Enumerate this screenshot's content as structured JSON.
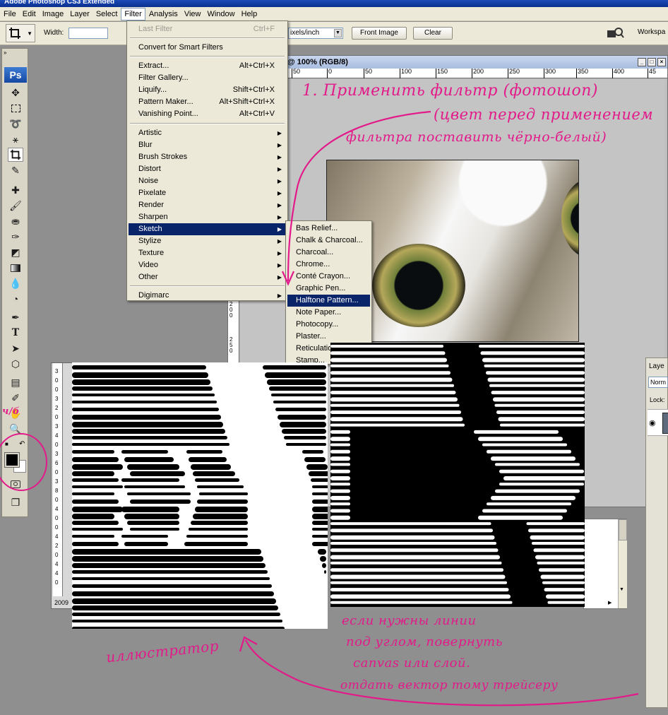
{
  "app": {
    "title": "Adobe Photoshop CS3 Extended"
  },
  "menubar": [
    "File",
    "Edit",
    "Image",
    "Layer",
    "Select",
    "Filter",
    "Analysis",
    "View",
    "Window",
    "Help"
  ],
  "options": {
    "width_label": "Width:",
    "resolution_unit": "ixels/inch",
    "front_image": "Front Image",
    "clear": "Clear",
    "workspace": "Workspa"
  },
  "toolbox": {
    "logo": "Ps"
  },
  "document": {
    "title": "@ 100% (RGB/8)",
    "ruler_ticks": [
      "50",
      "0",
      "50",
      "100",
      "150",
      "200",
      "250",
      "300",
      "350",
      "400",
      "45"
    ],
    "vruler_ticks": [
      "2",
      "0",
      "0",
      "2",
      "5",
      "0"
    ],
    "left_vruler_ticks": [
      "3",
      "0",
      "0",
      "3",
      "2",
      "0",
      "3",
      "4",
      "0",
      "3",
      "6",
      "0",
      "3",
      "8",
      "0",
      "4",
      "0",
      "0",
      "4",
      "2",
      "0",
      "4",
      "4",
      "0"
    ],
    "status": "2009"
  },
  "filter_menu": {
    "items": [
      {
        "label": "Last Filter",
        "shortcut": "Ctrl+F",
        "disabled": true
      },
      {
        "label": "Convert for Smart Filters"
      },
      {
        "label": "Extract...",
        "shortcut": "Alt+Ctrl+X"
      },
      {
        "label": "Filter Gallery..."
      },
      {
        "label": "Liquify...",
        "shortcut": "Shift+Ctrl+X"
      },
      {
        "label": "Pattern Maker...",
        "shortcut": "Alt+Shift+Ctrl+X"
      },
      {
        "label": "Vanishing Point...",
        "shortcut": "Alt+Ctrl+V"
      },
      {
        "label": "Artistic"
      },
      {
        "label": "Blur"
      },
      {
        "label": "Brush Strokes"
      },
      {
        "label": "Distort"
      },
      {
        "label": "Noise"
      },
      {
        "label": "Pixelate"
      },
      {
        "label": "Render"
      },
      {
        "label": "Sharpen"
      },
      {
        "label": "Sketch",
        "highlighted": true
      },
      {
        "label": "Stylize"
      },
      {
        "label": "Texture"
      },
      {
        "label": "Video"
      },
      {
        "label": "Other"
      },
      {
        "label": "Digimarc"
      }
    ]
  },
  "sketch_submenu": {
    "items": [
      {
        "label": "Bas Relief..."
      },
      {
        "label": "Chalk & Charcoal..."
      },
      {
        "label": "Charcoal..."
      },
      {
        "label": "Chrome..."
      },
      {
        "label": "Conté Crayon..."
      },
      {
        "label": "Graphic Pen..."
      },
      {
        "label": "Halftone Pattern...",
        "highlighted": true
      },
      {
        "label": "Note Paper..."
      },
      {
        "label": "Photocopy..."
      },
      {
        "label": "Plaster..."
      },
      {
        "label": "Reticulatio"
      },
      {
        "label": "Stamp..."
      }
    ]
  },
  "layers": {
    "tab": "Laye",
    "blend": "Norm",
    "lock": "Lock:"
  },
  "annotations": {
    "step1_line1": "1. Применить фильтр (фотошоп)",
    "step1_line2": "(цвет перед применением",
    "step1_line3": "фильтра поставить чёрно-белый)",
    "toolbox_note": "ч/б",
    "illustrator": "иллюстратор",
    "note_line1": "если нужны линии",
    "note_line2": "под углом, повернуть",
    "note_line3": "canvas или слой.",
    "note_line4": "отдать вектор тому трейсеру"
  },
  "colors": {
    "menu_highlight": "#0a246a",
    "annotation_pink": "#e21a8a",
    "titlebar": "#0a2f8f"
  }
}
